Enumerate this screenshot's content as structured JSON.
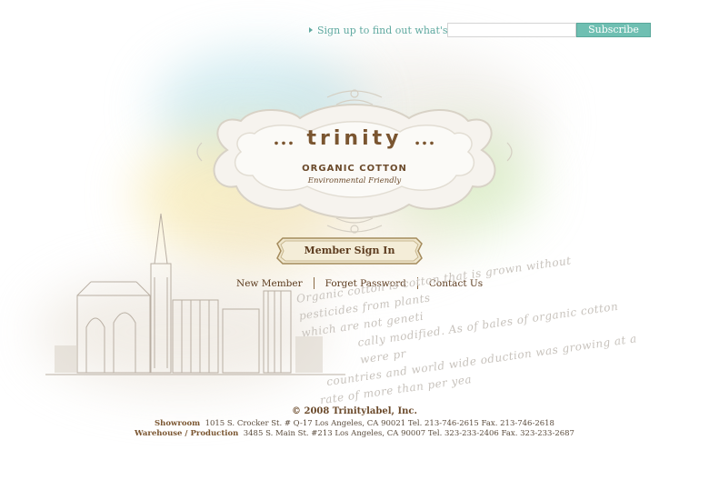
{
  "subscribe": {
    "prompt": "Sign up to find out what's new",
    "email_value": "",
    "button_label": "Subscribe Now"
  },
  "logo": {
    "dots": "...",
    "brand": "trinity",
    "tagline": "ORGANIC COTTON",
    "subtagline": "Environmental Friendly"
  },
  "signin": {
    "label": "Member Sign In"
  },
  "links": [
    {
      "label": "New Member"
    },
    {
      "label": "Forget Password"
    },
    {
      "label": "Contact Us"
    }
  ],
  "script_text": {
    "line1": "Organic cotton is cotton that is grown without pesticides from plants",
    "line2": "which are not geneti",
    "line3": "cally modified. As of bales of organic cotton were pr",
    "line4": "countries and world wide oduction was growing at a",
    "line5": "rate of more than per yea"
  },
  "footer": {
    "copyright": "© 2008 Trinitylabel, Inc.",
    "showroom_label": "Showroom",
    "showroom_address": "1015 S. Crocker St. # Q-17 Los Angeles, CA 90021 Tel. 213-746-2615   Fax. 213-746-2618",
    "warehouse_label": "Warehouse / Production",
    "warehouse_address": "3485 S. Main St. #213 Los Angeles, CA 90007  Tel. 323-233-2406   Fax. 323-233-2687"
  },
  "colors": {
    "accent_teal": "#6fbfb2",
    "brand_brown": "#7a5530"
  }
}
